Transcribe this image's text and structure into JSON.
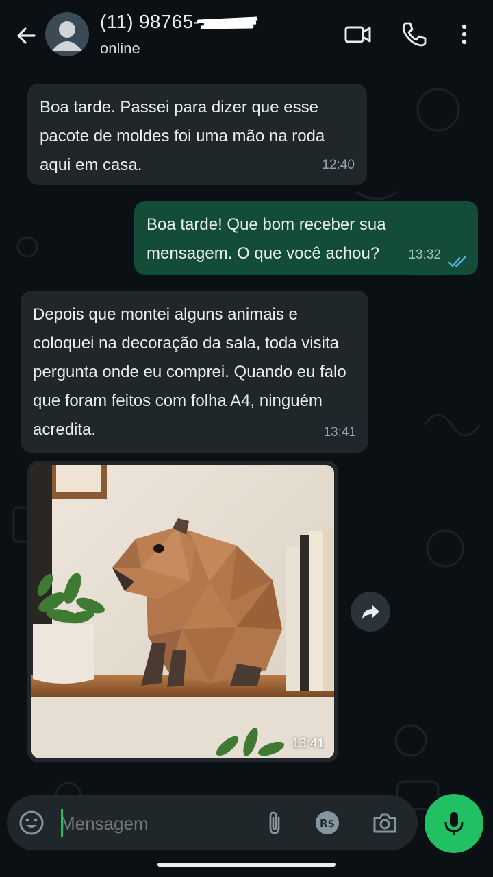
{
  "header": {
    "contact_number": "(11) 98765-",
    "status": "online"
  },
  "messages": [
    {
      "direction": "in",
      "text": "Boa tarde. Passei para dizer que esse pacote de moldes foi uma mão na roda aqui em casa.",
      "time": "12:40"
    },
    {
      "direction": "out",
      "text": "Boa tarde! Que bom receber sua mensagem. O que você achou?",
      "time": "13:32",
      "status": "read"
    },
    {
      "direction": "in",
      "text": "Depois que montei alguns animais e coloquei na decoração da sala, toda visita pergunta onde eu comprei. Quando eu falo que foram feitos com folha A4, ninguém acredita.",
      "time": "13:41"
    },
    {
      "direction": "in",
      "type": "image",
      "time": "13:41"
    }
  ],
  "composer": {
    "placeholder": "Mensagem"
  },
  "icons": {
    "back": "arrow-left-icon",
    "video": "video-camera-icon",
    "call": "phone-icon",
    "menu": "more-vertical-icon",
    "emoji": "emoji-icon",
    "attach": "paperclip-icon",
    "payment": "real-currency-icon",
    "camera": "camera-icon",
    "mic": "microphone-icon",
    "forward": "forward-icon"
  },
  "colors": {
    "background": "#0b1014",
    "incoming_bubble": "#1f272a",
    "outgoing_bubble": "#134d37",
    "accent_green": "#21c063",
    "read_ticks": "#53bdeb"
  }
}
